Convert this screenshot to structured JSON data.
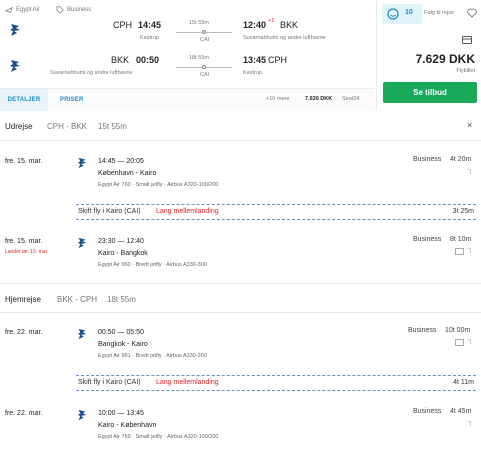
{
  "header": {
    "airline_name": "Egypt Air",
    "fare_tag": "Business",
    "outbound": {
      "dep_code": "CPH",
      "dep_time": "14:45",
      "dep_airport": "Kastrup",
      "duration": "15t 55m",
      "stop": "CAI",
      "arr_time": "12:40",
      "day_offset": "+1",
      "arr_code": "BKK",
      "arr_airport": "Suvarnabhumi og andre lufthavne"
    },
    "inbound": {
      "dep_code": "BKK",
      "dep_time": "00:50",
      "dep_airport": "Suvarnabhumi og andre lufthavne",
      "duration": "18t 55m",
      "stop": "CAI",
      "arr_time": "13:45",
      "arr_code": "CPH",
      "arr_airport": "Kastrup"
    }
  },
  "tabs": {
    "details": "DETALJER",
    "prices": "PRISER",
    "more": "+10 mere",
    "alt_price": "7.630 DKK",
    "alt_provider": "Seat24"
  },
  "side": {
    "likes": "10",
    "follow_label": "Følg til rejse",
    "price": "7.629 DKK",
    "price_sub": "Flybillet",
    "cta": "Se tilbud"
  },
  "outbound_detail": {
    "label": "Udrejse",
    "route": "CPH - BKK",
    "duration": "15t 55m",
    "segments": [
      {
        "date": "fre. 15. mar.",
        "date_note": "",
        "times": "14:45 — 20:05",
        "route": "København - Kairo",
        "meta": "Egypt Air 760 · Smalt jetfly · Airbus A320-100/200",
        "cabin": "Business",
        "duration": "4t 20m"
      },
      {
        "date": "fre. 15. mar.",
        "date_note": "Lander lør. 16. mar.",
        "times": "23:30 — 12:40",
        "route": "Kairo - Bangkok",
        "meta": "Egypt Air 960 · Bredt jetfly · Airbus A330-300",
        "cabin": "Business",
        "duration": "8t 10m"
      }
    ],
    "layover": {
      "text": "Skift fly i Kairo (CAI)",
      "warn": "Lang mellemlanding",
      "duration": "3t 25m"
    }
  },
  "inbound_detail": {
    "label": "Hjemrejse",
    "route": "BKK - CPH",
    "duration": "18t 55m",
    "segments": [
      {
        "date": "fre. 22. mar.",
        "date_note": "",
        "times": "00:50 — 05:50",
        "route": "Bangkok - Kairo",
        "meta": "Egypt Air 961 · Bredt jetfly · Airbus A330-300",
        "cabin": "Business",
        "duration": "10t 00m"
      },
      {
        "date": "fre. 22. mar.",
        "date_note": "",
        "times": "10:00 — 13:45",
        "route": "Kairo - København",
        "meta": "Egypt Air 759 · Smalt jetfly · Airbus A320-100/200",
        "cabin": "Business",
        "duration": "4t 45m"
      }
    ],
    "layover": {
      "text": "Skift fly i Kairo (CAI)",
      "warn": "Lang mellemlanding",
      "duration": "4t 11m"
    }
  },
  "colors": {
    "accent_green": "#18a95a",
    "accent_blue": "#1a8cc7",
    "warn_red": "#e02424",
    "logo_blue": "#1d4f91"
  }
}
